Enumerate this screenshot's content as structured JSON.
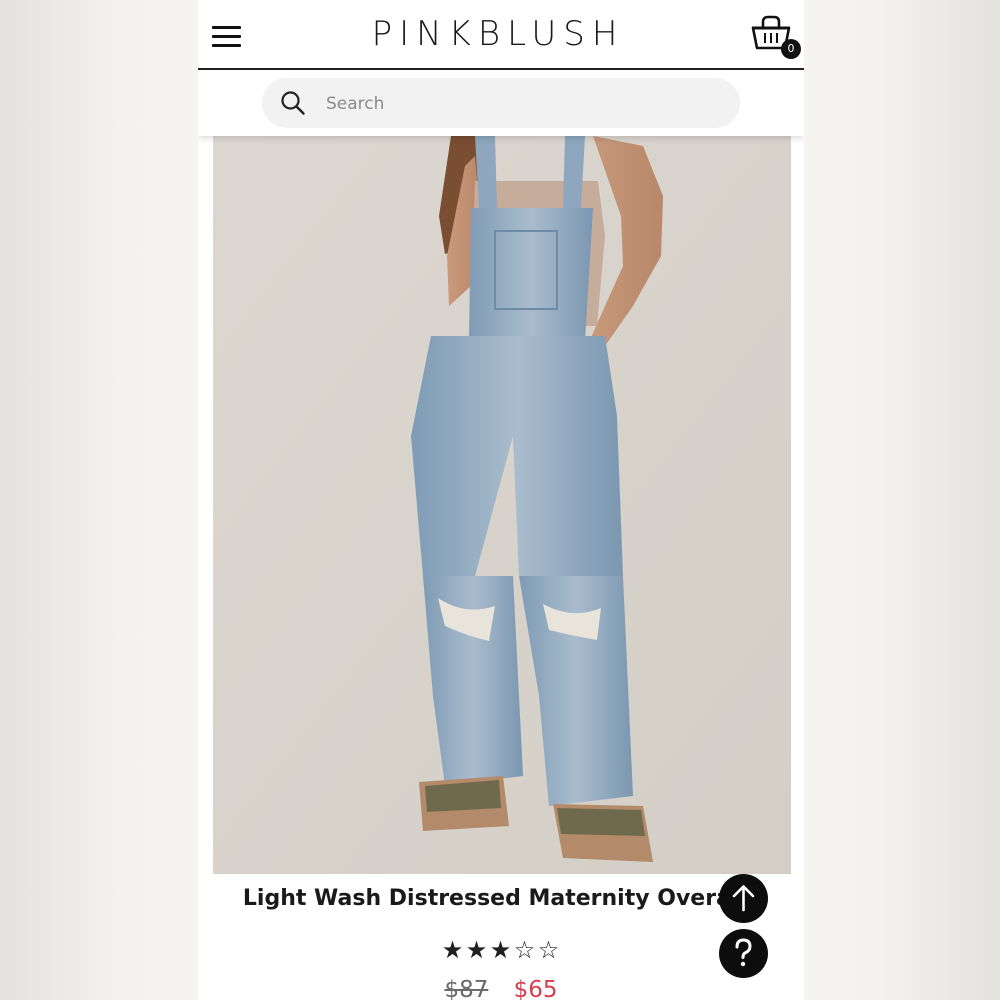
{
  "header": {
    "brand": "PINKBLUSH",
    "cart_count": "0",
    "menu_icon": "hamburger-menu-icon",
    "cart_icon": "shopping-basket-icon"
  },
  "search": {
    "placeholder": "Search",
    "value": "",
    "icon": "search-icon"
  },
  "product": {
    "title": "Light Wash Distressed Maternity Overalls",
    "rating": {
      "stars_filled": 3,
      "stars_total": 5
    },
    "price_original": "$87",
    "price_sale": "$65"
  },
  "floating_buttons": {
    "scroll_top_icon": "arrow-up-icon",
    "help_icon": "question-mark-icon"
  },
  "colors": {
    "sale_price": "#d63d4f",
    "fab_background": "#0d0d0d",
    "image_background": "#d9d4cd"
  }
}
